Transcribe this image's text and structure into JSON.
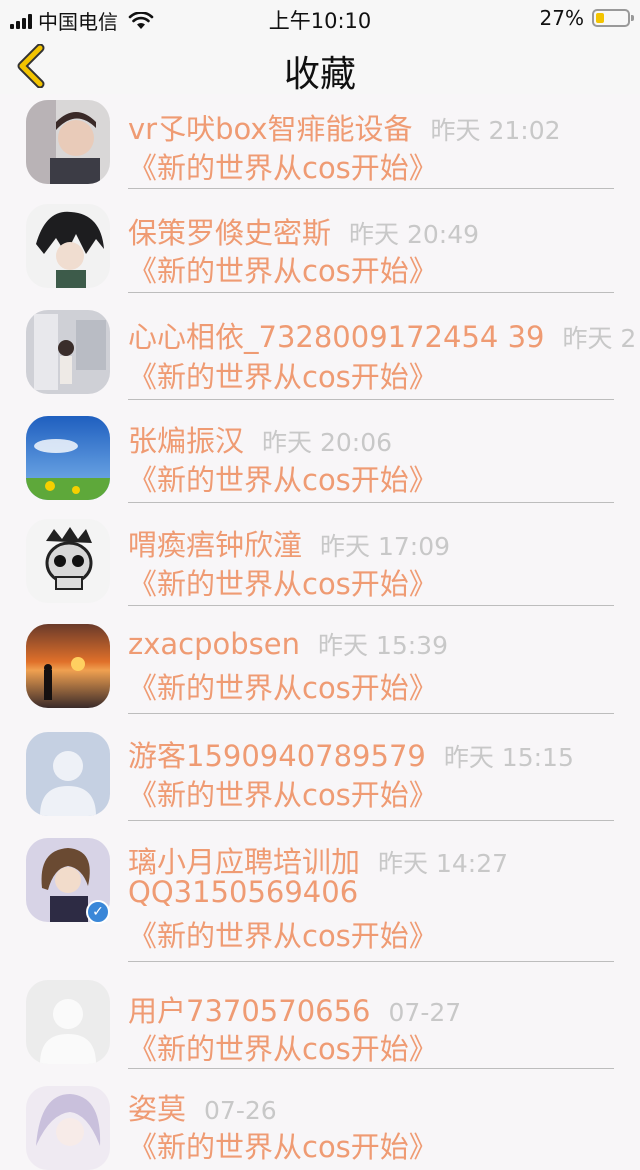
{
  "status_bar": {
    "carrier": "中国电信",
    "time": "上午10:10",
    "battery": "27%",
    "battery_level": 0.27
  },
  "nav": {
    "title": "收藏",
    "back_icon": "chevron-left-icon"
  },
  "items": [
    {
      "name": "vr孓吠box智痱能设备",
      "time": "昨天 21:02",
      "subtitle": "《新的世界从cos开始》"
    },
    {
      "name": "保策罗倏史密斯",
      "time": "昨天 20:49",
      "subtitle": "《新的世界从cos开始》"
    },
    {
      "name": "心心相依_7328009172454 39",
      "time": "昨天 2",
      "subtitle": "《新的世界从cos开始》"
    },
    {
      "name": "张煸振汉",
      "time": "昨天 20:06",
      "subtitle": "《新的世界从cos开始》"
    },
    {
      "name": "喟瘓痦钟欣潼",
      "time": "昨天 17:09",
      "subtitle": "《新的世界从cos开始》"
    },
    {
      "name": "zxacpobsen",
      "time": "昨天 15:39",
      "subtitle": "《新的世界从cos开始》"
    },
    {
      "name": "游客1590940789579",
      "time": "昨天 15:15",
      "subtitle": "《新的世界从cos开始》"
    },
    {
      "name": "璃小月应聘培训加",
      "name_line2": "QQ3150569406",
      "time": "昨天 14:27",
      "subtitle": "《新的世界从cos开始》"
    },
    {
      "name": "用户7370570656",
      "time": "07-27",
      "subtitle": "《新的世界从cos开始》"
    },
    {
      "name": "姿莫",
      "time": "07-26",
      "subtitle": "《新的世界从cos开始》"
    }
  ]
}
